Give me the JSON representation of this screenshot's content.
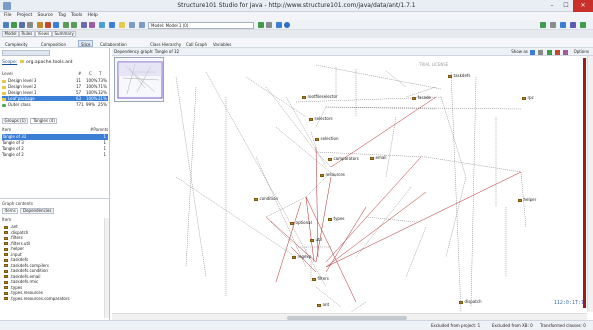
{
  "window": {
    "title": "Structure101 Studio for Java - http://www.structure101.com/java/data/ant/1.7.1",
    "controls": [
      "–",
      "☐",
      "✕"
    ]
  },
  "menu": [
    "File",
    "Project",
    "Source",
    "Tag",
    "Tools",
    "Help"
  ],
  "toolbar": {
    "model_select": "Model: Model 1 (0)"
  },
  "view_tabs": [
    "Model",
    "Rules",
    "Views",
    "Summary"
  ],
  "subtabs": [
    "Complexity",
    "Composition",
    "Slice",
    "Collaboration",
    "Class Hierarchy",
    "Call Graph",
    "Variables"
  ],
  "left": {
    "scope_label": "Scope:",
    "scope_value": "org.apache.tools.ant",
    "columns": [
      "Level",
      "#",
      "C",
      "T"
    ],
    "levels": [
      {
        "name": "Design level 3",
        "n": "11",
        "c": "100%",
        "t": "73%",
        "color": "#e6c84a"
      },
      {
        "name": "Design level 2",
        "n": "17",
        "c": "100%",
        "t": "71%",
        "color": "#e6c84a"
      },
      {
        "name": "Design level 1",
        "n": "57",
        "c": "100%",
        "t": "32%",
        "color": "#e6c84a"
      },
      {
        "name": "Leaf package",
        "n": "63",
        "c": "100%",
        "t": "31%",
        "color": "#e6c84a"
      },
      {
        "name": "Outer class",
        "n": "771",
        "c": "99%",
        "t": "25%",
        "color": "#4aa84a"
      }
    ],
    "tangle_tabs": [
      "Groups (1)",
      "Tangles (4)"
    ],
    "tangle_columns": [
      "Item",
      "#Parents"
    ],
    "tangles": [
      {
        "name": "Tangle of 32",
        "count": "1"
      },
      {
        "name": "Tangle of 3",
        "count": "1"
      },
      {
        "name": "Tangle of 2",
        "count": "1"
      },
      {
        "name": "Tangle of 2",
        "count": "1"
      }
    ],
    "graph_contents_label": "Graph contents",
    "contents_tabs": [
      "Items",
      "Dependencies"
    ],
    "item_col": "Item",
    "items": [
      ".ant",
      ".dispatch",
      ".filters",
      ".filters.util",
      ".helper",
      ".input",
      ".taskdefs",
      ".taskdefs.compilers",
      ".taskdefs.condition",
      ".taskdefs.email",
      ".taskdefs.rmic",
      ".types",
      ".types.resources",
      ".types.resources.comparators"
    ]
  },
  "graph": {
    "header": "Dependency graph: Tangle of 32",
    "show_as": "Show as",
    "options": "Options",
    "watermark": "TRIAL LICENSE",
    "size_info": "112:0:1T:1",
    "nodes": [
      {
        "name": "taskdefs"
      },
      {
        "name": "rootfileselector"
      },
      {
        "name": "facade"
      },
      {
        "name": "rpc"
      },
      {
        "name": "selectors"
      },
      {
        "name": "selection"
      },
      {
        "name": "comparators"
      },
      {
        "name": "email"
      },
      {
        "name": "resources"
      },
      {
        "name": "condition"
      },
      {
        "name": "helper"
      },
      {
        "name": "optional"
      },
      {
        "name": "types"
      },
      {
        "name": "util"
      },
      {
        "name": "regexp"
      },
      {
        "name": "filters"
      },
      {
        "name": "ant"
      },
      {
        "name": "dispatch"
      }
    ]
  },
  "status": {
    "excluded_project": "Excluded from project: 1",
    "excluded_xb": "Excluded from XB: 0",
    "transformed": "Transformed classes: 0"
  }
}
